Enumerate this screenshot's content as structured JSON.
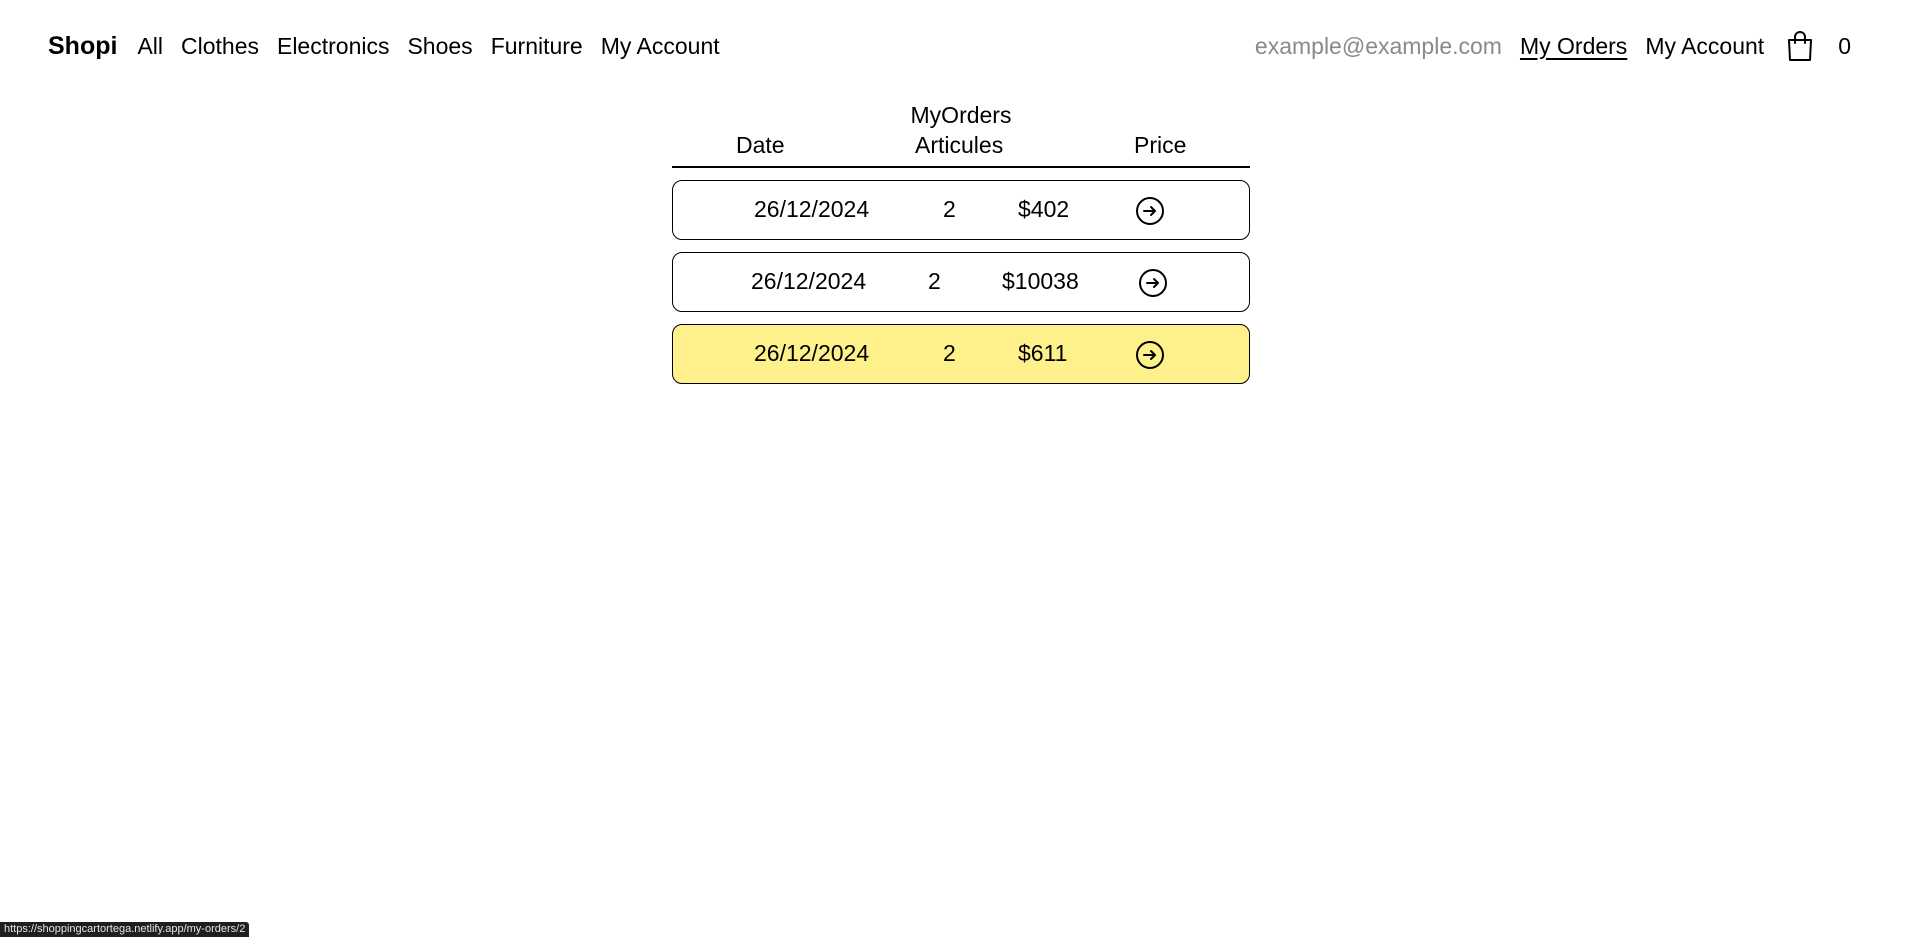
{
  "navbar": {
    "brand": "Shopi",
    "categories": [
      "All",
      "Clothes",
      "Electronics",
      "Shoes",
      "Furniture",
      "My Account"
    ],
    "email": "example@example.com",
    "my_orders": "My Orders",
    "my_account": "My Account",
    "cart_count": "0",
    "cart_icon": "shopping-bag-icon"
  },
  "orders": {
    "title": "MyOrders",
    "headers": {
      "date": "Date",
      "articles": "Articules",
      "price": "Price"
    },
    "rows": [
      {
        "date": "26/12/2024",
        "articles": "2",
        "price": "$402",
        "highlighted": false
      },
      {
        "date": "26/12/2024",
        "articles": "2",
        "price": "$10038",
        "highlighted": false
      },
      {
        "date": "26/12/2024",
        "articles": "2",
        "price": "$611",
        "highlighted": true
      }
    ],
    "row_icon": "arrow-right-circle-icon",
    "highlight_color": "#fef08a"
  },
  "status_bar": {
    "url": "https://shoppingcartortega.netlify.app/my-orders/2"
  }
}
